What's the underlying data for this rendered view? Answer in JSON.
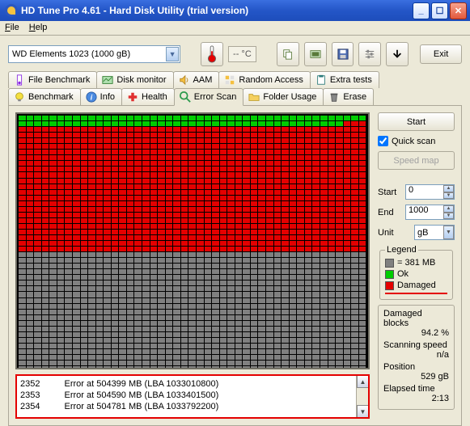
{
  "window": {
    "title": "HD Tune Pro 4.61 - Hard Disk Utility (trial version)"
  },
  "menu": {
    "file": "File",
    "help": "Help"
  },
  "drive": {
    "label": "WD    Elements 1023   (1000 gB)"
  },
  "temp": {
    "display": "-- °C"
  },
  "buttons": {
    "exit": "Exit",
    "start": "Start",
    "speedmap": "Speed map"
  },
  "tabs": {
    "row1": [
      {
        "label": "File Benchmark"
      },
      {
        "label": "Disk monitor"
      },
      {
        "label": "AAM"
      },
      {
        "label": "Random Access"
      },
      {
        "label": "Extra tests"
      }
    ],
    "row2": [
      {
        "label": "Benchmark"
      },
      {
        "label": "Info"
      },
      {
        "label": "Health"
      },
      {
        "label": "Error Scan"
      },
      {
        "label": "Folder Usage"
      },
      {
        "label": "Erase"
      }
    ]
  },
  "scan": {
    "quickscan_label": "Quick scan",
    "start_label": "Start",
    "start_value": "0",
    "end_label": "End",
    "end_value": "1000",
    "unit_label": "Unit",
    "unit_value": "gB"
  },
  "legend": {
    "title": "Legend",
    "blocksize": "= 381 MB",
    "ok": "Ok",
    "damaged": "Damaged"
  },
  "stats": {
    "damaged_label": "Damaged blocks",
    "damaged_value": "94.2 %",
    "speed_label": "Scanning speed",
    "speed_value": "n/a",
    "position_label": "Position",
    "position_value": "529 gB",
    "elapsed_label": "Elapsed time",
    "elapsed_value": "2:13"
  },
  "log": [
    {
      "num": "2352",
      "msg": "Error at 504399 MB (LBA 1033010800)"
    },
    {
      "num": "2353",
      "msg": "Error at 504590 MB (LBA 1033401500)"
    },
    {
      "num": "2354",
      "msg": "Error at 504781 MB (LBA 1033792200)"
    }
  ],
  "grid": {
    "cols": 45,
    "rows_green_full": 1,
    "row_green_partial_count": 42,
    "rows_red_end": 23,
    "rows_total": 45
  }
}
